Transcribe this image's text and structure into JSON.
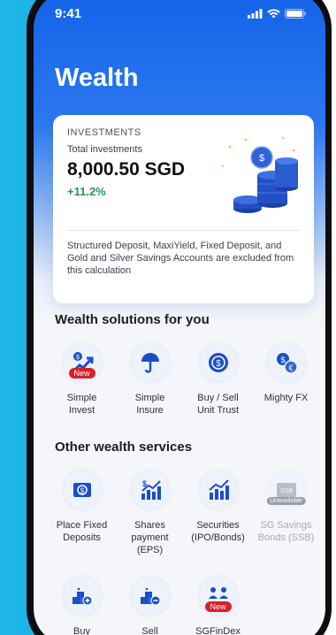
{
  "status": {
    "time": "9:41"
  },
  "page": {
    "title": "Wealth"
  },
  "investments": {
    "label": "INVESTMENTS",
    "subtitle": "Total investments",
    "amount": "8,000.50 SGD",
    "change": "+11.2%",
    "note": "Structured Deposit, MaxiYield, Fixed Deposit, and Gold and Silver Savings Accounts are excluded from this calculation"
  },
  "solutions": {
    "title": "Wealth solutions for you",
    "items": [
      {
        "label": "Simple\nInvest",
        "icon": "chart-up-icon",
        "badge": "New"
      },
      {
        "label": "Simple\nInsure",
        "icon": "umbrella-icon"
      },
      {
        "label": "Buy / Sell\nUnit Trust",
        "icon": "coin-icon"
      },
      {
        "label": "Mighty FX",
        "icon": "currency-exchange-icon"
      }
    ]
  },
  "services": {
    "title": "Other wealth services",
    "items": [
      {
        "label": "Place Fixed\nDeposits",
        "icon": "dollar-note-icon"
      },
      {
        "label": "Shares\npayment\n(EPS)",
        "icon": "shares-chart-icon"
      },
      {
        "label": "Securities\n(IPO/Bonds)",
        "icon": "bar-chart-icon"
      },
      {
        "label": "SG Savings\nBonds (SSB)",
        "icon": "bond-icon",
        "badge": "Unavailable",
        "ssb": "SSB"
      }
    ],
    "row2": [
      {
        "label": "Buy",
        "icon": "gold-plus-icon"
      },
      {
        "label": "Sell",
        "icon": "gold-minus-icon"
      },
      {
        "label": "SGFinDex",
        "icon": "people-icon",
        "badge": "New"
      }
    ]
  },
  "colors": {
    "accent": "#1463e8",
    "positive": "#1f9a4b",
    "badge": "#d8202a"
  }
}
